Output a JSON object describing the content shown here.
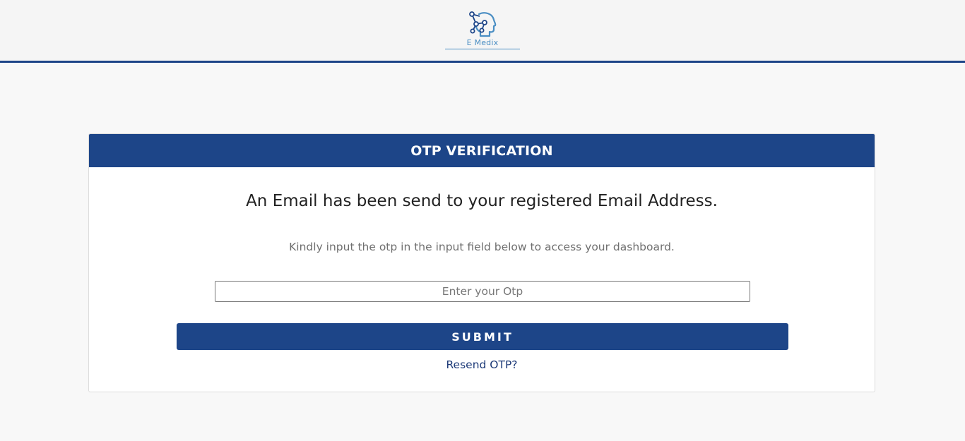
{
  "header": {
    "logo_text": "E Medix",
    "logo_icon": "head-network-icon",
    "accent_color": "#1d4588",
    "logo_color": "#4a8ec3"
  },
  "card": {
    "title": "OTP VERIFICATION",
    "headline": "An Email has been send to your registered Email Address.",
    "subtext": "Kindly input the otp in the input field below to access your dashboard.",
    "otp_input": {
      "value": "",
      "placeholder": "Enter your Otp"
    },
    "submit_label": "SUBMIT",
    "resend_label": "Resend OTP?"
  }
}
